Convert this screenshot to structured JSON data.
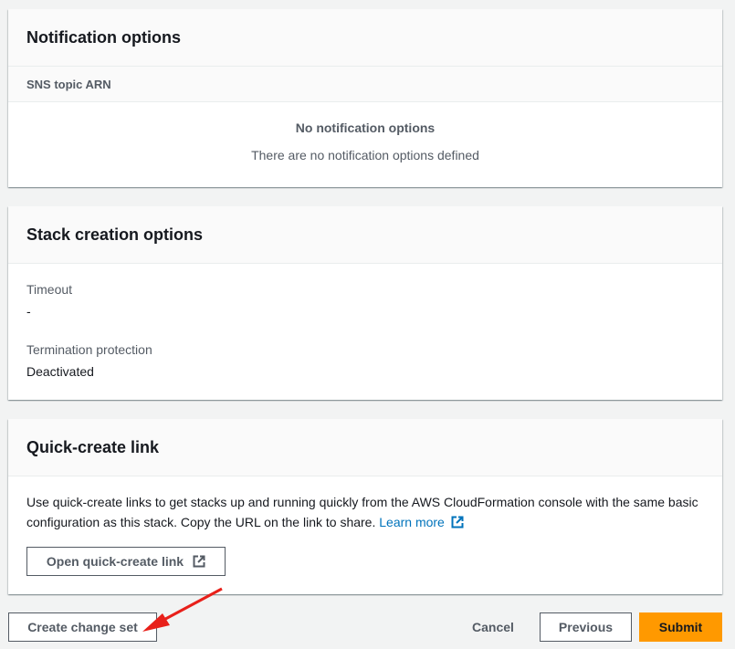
{
  "notification": {
    "title": "Notification options",
    "column": "SNS topic ARN",
    "empty_title": "No notification options",
    "empty_desc": "There are no notification options defined"
  },
  "stack_options": {
    "title": "Stack creation options",
    "timeout_label": "Timeout",
    "timeout_value": "-",
    "termination_label": "Termination protection",
    "termination_value": "Deactivated"
  },
  "quick_create": {
    "title": "Quick-create link",
    "description": "Use quick-create links to get stacks up and running quickly from the AWS CloudFormation console with the same basic configuration as this stack. Copy the URL on the link to share.",
    "learn_more": "Learn more",
    "open_button": "Open quick-create link"
  },
  "footer": {
    "create_change_set": "Create change set",
    "cancel": "Cancel",
    "previous": "Previous",
    "submit": "Submit"
  },
  "colors": {
    "accent": "#ec7211",
    "primary_button": "#ff9900",
    "link": "#0073bb",
    "annotation_arrow": "#e8201a"
  }
}
